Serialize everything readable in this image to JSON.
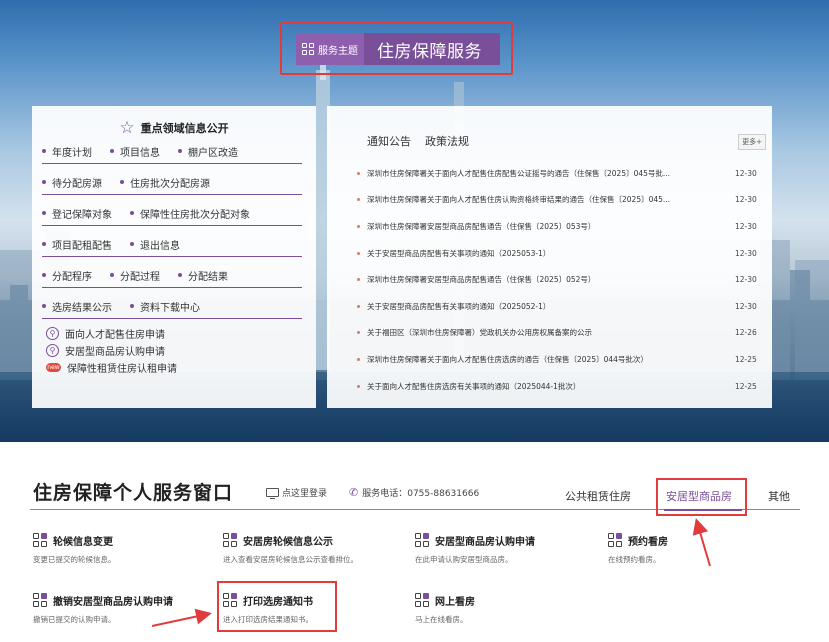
{
  "service": {
    "badge": "服务主题",
    "title": "住房保障服务"
  },
  "left_panel": {
    "title": "重点领域信息公开",
    "rows": [
      [
        "年度计划",
        "项目信息",
        "棚户区改造"
      ],
      [
        "待分配房源",
        "住房批次分配房源"
      ],
      [
        "登记保障对象",
        "保障性住房批次分配对象"
      ],
      [
        "项目配租配售",
        "退出信息"
      ],
      [
        "分配程序",
        "分配过程",
        "分配结果"
      ],
      [
        "选房结果公示",
        "资料下载中心"
      ]
    ],
    "links": [
      {
        "icon": "person-icon",
        "label": "面向人才配售住房申请"
      },
      {
        "icon": "person-icon",
        "label": "安居型商品房认购申请"
      },
      {
        "icon": "new-badge",
        "badge": "new",
        "label": "保障性租赁住房认租申请"
      }
    ]
  },
  "right_panel": {
    "tabs": [
      "通知公告",
      "政策法规"
    ],
    "more": "更多+",
    "items": [
      {
        "title": "深圳市住房保障署关于面向人才配售住房配售公证摇号的通告（住保售〔2025〕045号批...",
        "date": "12-30"
      },
      {
        "title": "深圳市住房保障署关于面向人才配售住房认购资格终审结果的通告（住保售〔2025〕045...",
        "date": "12-30"
      },
      {
        "title": "深圳市住房保障署安居型商品房配售通告（住保售〔2025〕053号）",
        "date": "12-30"
      },
      {
        "title": "关于安居型商品房配售有关事项的通知（2025053-1）",
        "date": "12-30"
      },
      {
        "title": "深圳市住房保障署安居型商品房配售通告（住保售〔2025〕052号）",
        "date": "12-30"
      },
      {
        "title": "关于安居型商品房配售有关事项的通知（2025052-1）",
        "date": "12-30"
      },
      {
        "title": "关于福田区（深圳市住房保障署）党政机关办公用房权属备案的公示",
        "date": "12-26"
      },
      {
        "title": "深圳市住房保障署关于面向人才配售住房选房的通告（住保售〔2025〕044号批次）",
        "date": "12-25"
      },
      {
        "title": "关于面向人才配售住房选房有关事项的通知（2025044-1批次）",
        "date": "12-25"
      }
    ]
  },
  "window": {
    "title": "住房保障个人服务窗口",
    "login": "点这里登录",
    "hotline": "服务电话：0755-88631666",
    "tabs": [
      "公共租赁住房",
      "安居型商品房",
      "其他"
    ],
    "active_tab": "安居型商品房"
  },
  "services": [
    {
      "title": "轮候信息变更",
      "desc": "变更已提交的轮候信息。"
    },
    {
      "title": "安居房轮候信息公示",
      "desc": "进入查看安居房轮候信息公示查看排位。"
    },
    {
      "title": "安居型商品房认购申请",
      "desc": "在此申请认购安居型商品房。"
    },
    {
      "title": "预约看房",
      "desc": "在线预约看房。"
    },
    {
      "title": "撤销安居型商品房认购申请",
      "desc": "撤销已提交的认购申请。"
    },
    {
      "title": "打印选房通知书",
      "desc": "进入打印选房结果通知书。"
    },
    {
      "title": "网上看房",
      "desc": "马上在线看房。"
    }
  ],
  "colors": {
    "accent": "#7a4f9a",
    "highlight_frame": "#e23b3b",
    "bullet": "#e07a5f"
  }
}
